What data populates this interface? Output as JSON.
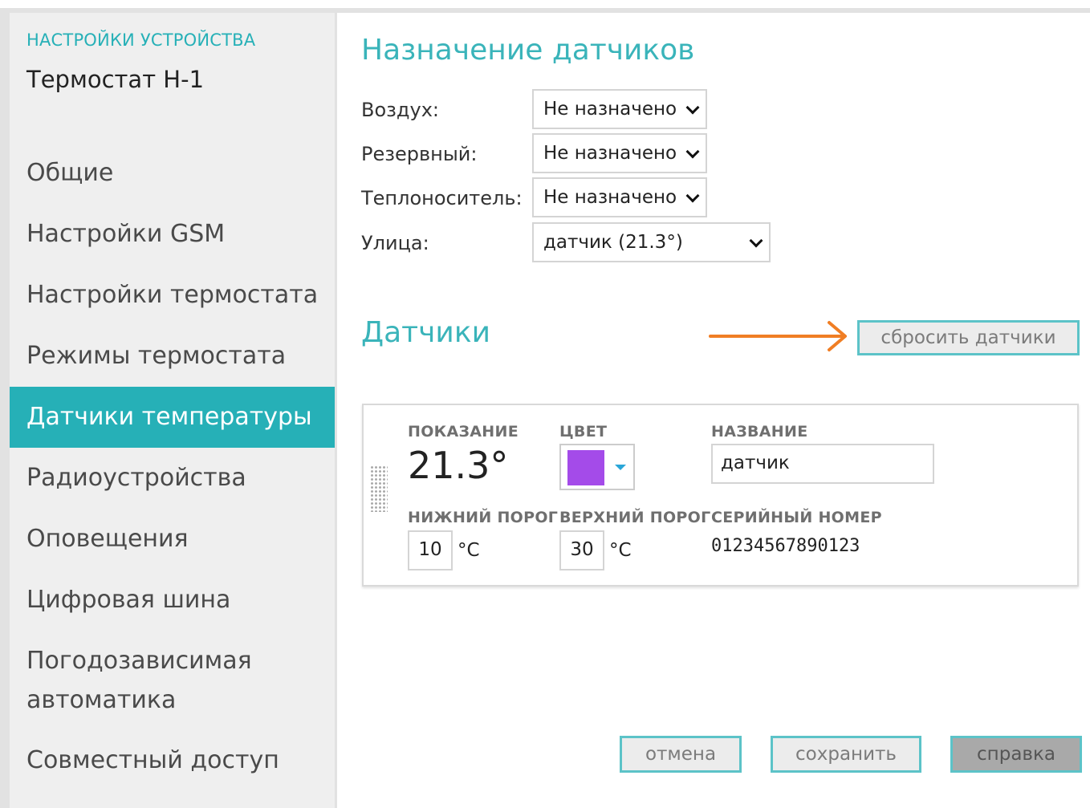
{
  "sidebar": {
    "caption": "НАСТРОЙКИ УСТРОЙСТВА",
    "device": "Термостат Н-1",
    "items": [
      {
        "label": "Общие"
      },
      {
        "label": "Настройки GSM"
      },
      {
        "label": "Настройки термостата"
      },
      {
        "label": "Режимы термостата"
      },
      {
        "label": "Датчики температуры",
        "active": true
      },
      {
        "label": "Радиоустройства"
      },
      {
        "label": "Оповещения"
      },
      {
        "label": "Цифровая шина"
      },
      {
        "label": "Погодозависимая автоматика"
      },
      {
        "label": "Совместный доступ"
      }
    ]
  },
  "assign": {
    "title": "Назначение датчиков",
    "rows": [
      {
        "label": "Воздух:",
        "value": "Не назначено"
      },
      {
        "label": "Резервный:",
        "value": "Не назначено"
      },
      {
        "label": "Теплоноситель:",
        "value": "Не назначено"
      },
      {
        "label": "Улица:",
        "value": "датчик (21.3°)"
      }
    ]
  },
  "sensors": {
    "title": "Датчики",
    "reset_label": "сбросить датчики",
    "card": {
      "reading_label": "ПОКАЗАНИЕ",
      "reading": "21.3°",
      "color_label": "ЦВЕТ",
      "color": "#a44be9",
      "name_label": "НАЗВАНИЕ",
      "name": "датчик",
      "low_label": "НИЖНИЙ ПОРОГ",
      "low": "10",
      "high_label": "ВЕРХНИЙ ПОРОГ",
      "high": "30",
      "unit": "°C",
      "serial_label": "СЕРИЙНЫЙ НОМЕР",
      "serial": "01234567890123"
    }
  },
  "footer": {
    "cancel_label": "отмена",
    "save_label": "сохранить",
    "help_label": "справка"
  },
  "colors": {
    "accent": "#26b0b7",
    "arrow": "#f07e24"
  }
}
